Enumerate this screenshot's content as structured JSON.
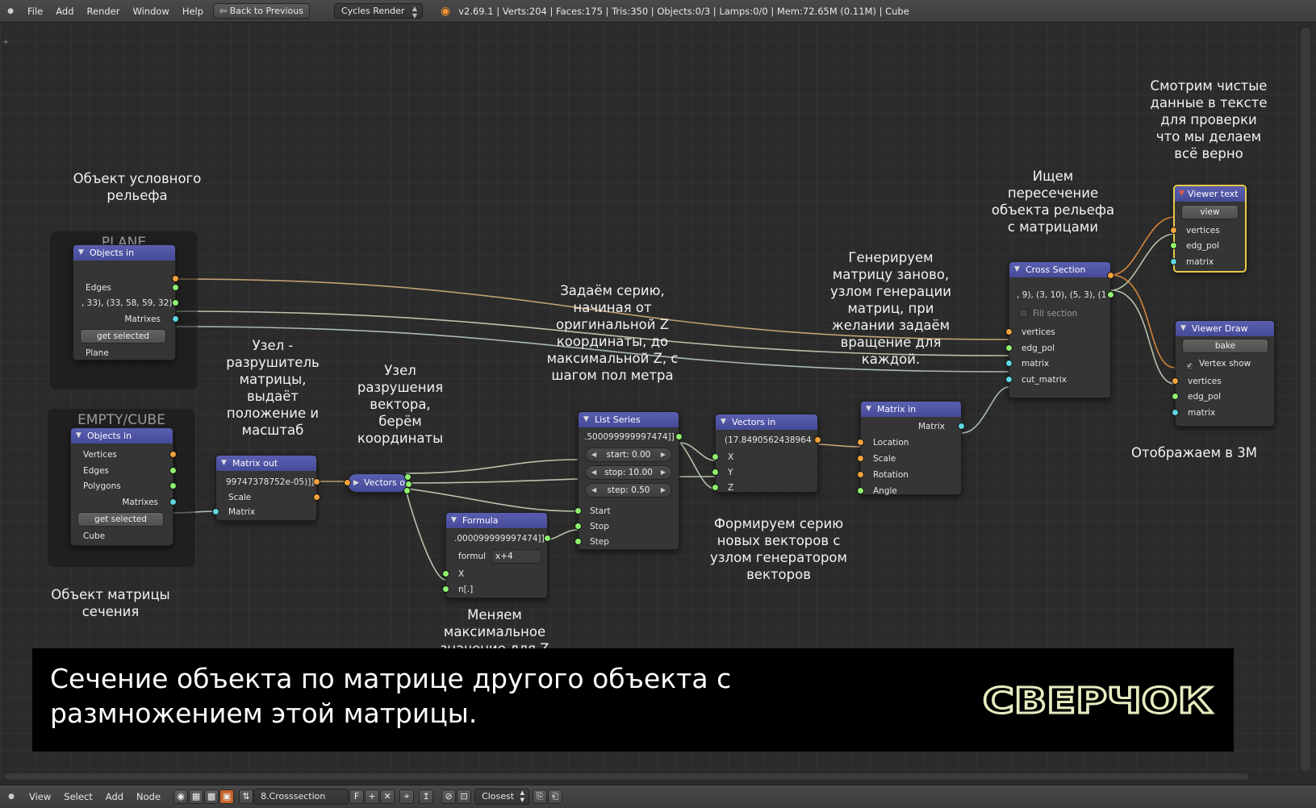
{
  "topbar": {
    "menus": [
      "File",
      "Add",
      "Render",
      "Window",
      "Help"
    ],
    "back_button": "Back to Previous",
    "render_engine": "Cycles Render",
    "stats": "v2.69.1 | Verts:204 | Faces:175 | Tris:350 | Objects:0/3 | Lamps:0/0 | Mem:72.65M (0.11M) | Cube"
  },
  "frames": {
    "plane": "PLANE",
    "empty_cube": "EMPTY/CUBE"
  },
  "nodes": {
    "objects_in_plane": {
      "title": "Objects in",
      "edges": "Edges",
      "value": ", 33), (33, 58, 59, 32)",
      "matrixes": "Matrixes",
      "button": "get selected",
      "object": "Plane"
    },
    "objects_in_cube": {
      "title": "Objects in",
      "vertices": "Vertices",
      "edges": "Edges",
      "polygons": "Polygons",
      "matrixes": "Matrixes",
      "button": "get selected",
      "object": "Cube"
    },
    "matrix_out": {
      "title": "Matrix out",
      "value": "99747378752e-05)]]",
      "scale": "Scale",
      "matrix": "Matrix"
    },
    "vectors_out": {
      "title": "Vectors o"
    },
    "formula": {
      "title": "Formula",
      "value": ".000099999997474]]",
      "formula_label": "formul",
      "formula_value": "x+4",
      "x": "X",
      "n": "n[.]"
    },
    "list_series": {
      "title": "List Series",
      "value": ".500099999997474]]",
      "start": "start: 0.00",
      "stop": "stop: 10.00",
      "step": "step: 0.50",
      "start_in": "Start",
      "stop_in": "Stop",
      "step_in": "Step"
    },
    "vectors_in": {
      "title": "Vectors in",
      "value": "(17.8490562438964",
      "x": "X",
      "y": "Y",
      "z": "Z"
    },
    "matrix_in": {
      "title": "Matrix in",
      "matrix": "Matrix",
      "location": "Location",
      "scale": "Scale",
      "rotation": "Rotation",
      "angle": "Angle"
    },
    "cross_section": {
      "title": "Cross Section",
      "value": ", 9), (3, 10), (5, 3), (1",
      "fill": "Fill section",
      "vertices": "vertices",
      "edg_pol": "edg_pol",
      "matrix": "matrix",
      "cut_matrix": "cut_matrix"
    },
    "viewer_text": {
      "title": "Viewer text",
      "button": "view",
      "vertices": "vertices",
      "edg_pol": "edg_pol",
      "matrix": "matrix"
    },
    "viewer_draw": {
      "title": "Viewer Draw",
      "button": "bake",
      "vertex_show": "Vertex show",
      "vertices": "vertices",
      "edg_pol": "edg_pol",
      "matrix": "matrix"
    }
  },
  "annotations": {
    "relief_object": "Объект условного\nрельефа",
    "matrix_breaker": "Узел -\nразрушитель\nматрицы,\nвыдаёт\nположение и\nмасштаб",
    "vector_breaker": "Узел\nразрушения\nвектора,\nберём\nкоординаты",
    "series": "Задаём серию,\nначиная от\nоригинальной Z\nкоординаты, до\nмаксимальной Z, с\nшагом пол метра",
    "regen_matrix": "Генерируем\nматрицу заново,\nузлом генерации\nматриц, при\nжелании задаём\nвращение для\nкаждой.",
    "intersection": "Ищем\nпересечение\nобъекта рельефа\nс матрицами",
    "check_text": "Смотрим чистые\nданные в тексте\nдля проверки\nчто мы делаем\nвсё верно",
    "show_3d": "Отображаем в 3М",
    "new_vectors": "Формируем серию\nновых векторов с\nузлом генератором\nвекторов",
    "max_z": "Меняем\nмаксимальное\nзначение для Z",
    "section_object": "Объект матрицы\nсечения"
  },
  "caption": {
    "title": "Сечение объекта по матрице другого объекта с\nразмножением этой матрицы.",
    "logo": "СВЕРЧОК"
  },
  "bottombar": {
    "menus": [
      "View",
      "Select",
      "Add",
      "Node"
    ],
    "nodetree": "8.Crosssection",
    "fake_user": "F",
    "snap_mode": "Closest"
  },
  "colors": {
    "node_header": "#4b50a0",
    "socket_orange": "#f2a23c",
    "socket_green": "#8ef26e",
    "socket_cyan": "#5fd4dd",
    "viewer_text_outline": "#e6c94a"
  }
}
